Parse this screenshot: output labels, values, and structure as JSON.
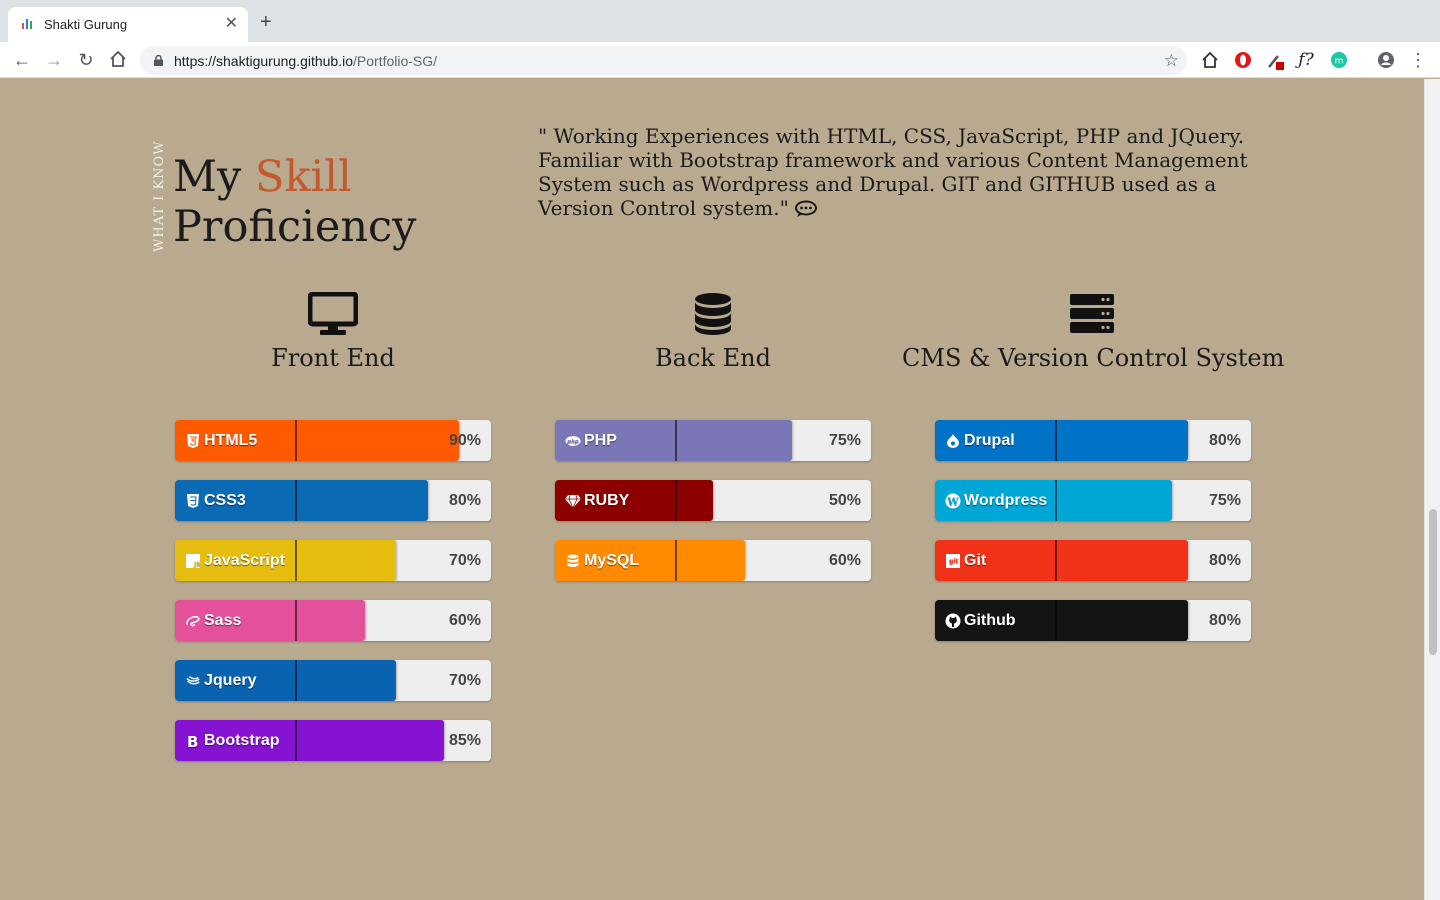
{
  "browser": {
    "tab_title": "Shakti Gurung",
    "url_host": "https://shaktigurung.github.io",
    "url_path": "/Portfolio-SG/"
  },
  "section": {
    "vertical_label": "WHAT I KNOW",
    "title_prefix": "My",
    "title_accent": "Skill",
    "title_second": "Proficiency",
    "accent_color": "#c35a2d",
    "quote": "\" Working Experiences with HTML, CSS, JavaScript, PHP and JQuery. Familiar with Bootstrap framework and various Content Management System such as Wordpress and Drupal. GIT and GITHUB used as a Version Control system.\""
  },
  "categories": [
    {
      "title": "Front End",
      "icon": "desktop-icon",
      "skills": [
        {
          "name": "HTML5",
          "percent": "90%",
          "level": 90,
          "color": "#ff5a00",
          "icon": "html5-icon"
        },
        {
          "name": "CSS3",
          "percent": "80%",
          "level": 80,
          "color": "#0a6ab4",
          "icon": "css3-icon"
        },
        {
          "name": "JavaScript",
          "percent": "70%",
          "level": 70,
          "color": "#e6bd0e",
          "icon": "js-icon"
        },
        {
          "name": "Sass",
          "percent": "60%",
          "level": 60,
          "color": "#e2519a",
          "icon": "sass-icon"
        },
        {
          "name": "Jquery",
          "percent": "70%",
          "level": 70,
          "color": "#0a63b0",
          "icon": "jquery-icon"
        },
        {
          "name": "Bootstrap",
          "percent": "85%",
          "level": 85,
          "color": "#8513d1",
          "icon": "bootstrap-icon"
        }
      ]
    },
    {
      "title": "Back End",
      "icon": "database-icon",
      "skills": [
        {
          "name": "PHP",
          "percent": "75%",
          "level": 75,
          "color": "#7b76b7",
          "icon": "php-icon"
        },
        {
          "name": "RUBY",
          "percent": "50%",
          "level": 50,
          "color": "#8c0000",
          "icon": "ruby-icon"
        },
        {
          "name": "MySQL",
          "percent": "60%",
          "level": 60,
          "color": "#ff8a00",
          "icon": "mysql-icon"
        }
      ]
    },
    {
      "title": "CMS & Version Control System",
      "icon": "server-icon",
      "skills": [
        {
          "name": "Drupal",
          "percent": "80%",
          "level": 80,
          "color": "#0073c6",
          "icon": "drupal-icon"
        },
        {
          "name": "Wordpress",
          "percent": "75%",
          "level": 75,
          "color": "#00a6d6",
          "icon": "wordpress-icon"
        },
        {
          "name": "Git",
          "percent": "80%",
          "level": 80,
          "color": "#f13218",
          "icon": "git-icon"
        },
        {
          "name": "Github",
          "percent": "80%",
          "level": 80,
          "color": "#141414",
          "icon": "github-icon"
        }
      ]
    }
  ]
}
